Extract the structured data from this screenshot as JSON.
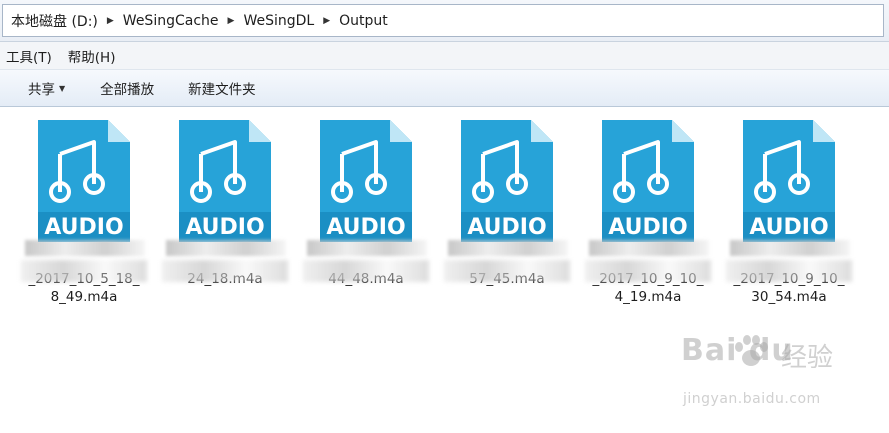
{
  "address": {
    "crumbs": [
      "本地磁盘 (D:)",
      "WeSingCache",
      "WeSingDL",
      "Output"
    ]
  },
  "menu": {
    "tools": "工具(T)",
    "help": "帮助(H)"
  },
  "toolbar": {
    "share": "共享",
    "play_all": "全部播放",
    "new_folder": "新建文件夹"
  },
  "files": [
    {
      "badge": "AUDIO",
      "name_line1": "_2017_10_5_18_",
      "name_line2": "8_49.m4a"
    },
    {
      "badge": "AUDIO",
      "name_line1": "24_18.m4a",
      "name_line2": ""
    },
    {
      "badge": "AUDIO",
      "name_line1": "44_48.m4a",
      "name_line2": ""
    },
    {
      "badge": "AUDIO",
      "name_line1": "57_45.m4a",
      "name_line2": ""
    },
    {
      "badge": "AUDIO",
      "name_line1": "_2017_10_9_10_",
      "name_line2": "4_19.m4a"
    },
    {
      "badge": "AUDIO",
      "name_line1": "_2017_10_9_10_",
      "name_line2": "30_54.m4a"
    }
  ],
  "icons": {
    "file": "audio-file-icon",
    "separator": "breadcrumb-arrow-icon",
    "dropdown": "caret-down-icon"
  },
  "colors": {
    "file_icon": "#27a3d8",
    "file_fold": "#bfe6f6",
    "badge_text": "#ffffff"
  },
  "watermark": {
    "logo": "Bai du",
    "cn": "经验",
    "url": "jingyan.baidu.com"
  }
}
